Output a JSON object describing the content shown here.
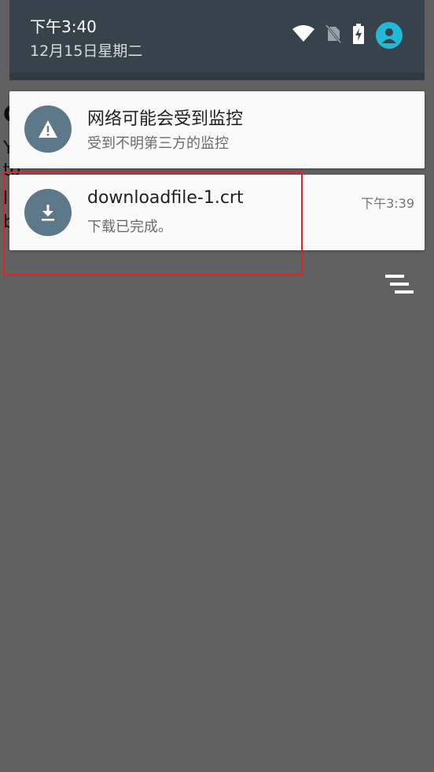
{
  "status_bar": {
    "time": "下午3:40",
    "date": "12月15日星期二"
  },
  "notifications": [
    {
      "title": "网络可能会受到监控",
      "subtitle": "受到不明第三方的监控",
      "icon": "warning-icon"
    },
    {
      "title": "downloadfile-1.crt",
      "subtitle": "下载已完成。",
      "time": "下午3:39",
      "icon": "download-icon"
    }
  ],
  "background_app": {
    "lines": [
      "C",
      "Y",
      "to",
      "l",
      "b"
    ]
  },
  "colors": {
    "header": "#37434b",
    "icon_circle": "#5d7888",
    "avatar": "#22b8d8",
    "highlight": "#e02424"
  }
}
